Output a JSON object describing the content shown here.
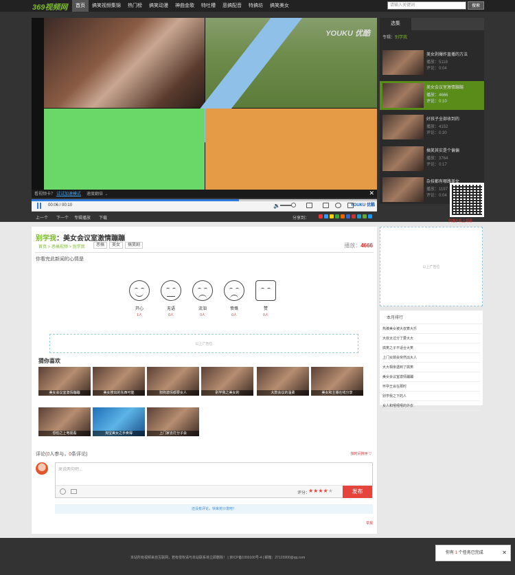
{
  "header": {
    "logo": "369视频网",
    "nav": [
      "首页",
      "搞笑视频集锦",
      "热门榜",
      "搞笑动漫",
      "神曲金歌",
      "特吐槽",
      "恶搞配音",
      "特搞坊",
      "搞笑美女"
    ],
    "search_placeholder": "请输入关键词",
    "search_button": "搜索"
  },
  "player": {
    "watermark": "YOUKU 优酷",
    "tip_prefix": "看视频卡？",
    "tip_link": "试试加速模式",
    "tip_suffix": "速度翻倍 →",
    "time": "00:06 / 00:10",
    "progress": 0.6,
    "youku_small": "YOUKU 优酷",
    "below_items": [
      "上一个",
      "下一个",
      "专辑播放",
      "下载"
    ],
    "share_label": "分享到："
  },
  "playlist": {
    "tab": "选集",
    "current_label": "专辑：",
    "current_name": "别学我",
    "items": [
      {
        "title": "美女剥爆炸直播的方法",
        "plays": "播放：5118",
        "comments": "评论：0:04"
      },
      {
        "title": "美女会议室激情蹦蹦",
        "plays": "播放：4666",
        "comments": "评论：0:10"
      },
      {
        "title": "好孩子全部收到的",
        "plays": "播放：4152",
        "comments": "评论：0:30"
      },
      {
        "title": "搞笑其实是个偏偏",
        "plays": "播放：3764",
        "comments": "评论：0:17"
      },
      {
        "title": "杂技都有哪路美女",
        "plays": "播放：1197",
        "comments": "评论：0:04"
      }
    ],
    "qr_caption": "扫描手机上观看"
  },
  "video_info": {
    "channel": "别学我",
    "title": "：美女会议室激情蹦蹦",
    "breadcrumb": "首页 > 恶搞视频 > 别学我",
    "tags": [
      "恶搞",
      "美女",
      "搞笑剧"
    ],
    "plays_label": "播放：",
    "plays": "4666"
  },
  "mood": {
    "title": "你看完此新闻的心情是",
    "items": [
      {
        "label": "开心",
        "count": "1人"
      },
      {
        "label": "无语",
        "count": "0人"
      },
      {
        "label": "流泪",
        "count": "0人"
      },
      {
        "label": "愤慨",
        "count": "0人"
      },
      {
        "label": "赞",
        "count": "0人"
      }
    ]
  },
  "ads": {
    "mid": "以上广告位",
    "side": "以上广告位"
  },
  "guess": {
    "title": "猜你喜欢",
    "items": [
      "美女会议室激情蹦蹦",
      "美女搜出的东西可能",
      "狗狗激情都要女人",
      "别学我之美女的",
      "大款会议的温柔",
      "美女和主播在线分享",
      "恐怕之上电视看",
      "淘宝美女之手卖得",
      "上门家去打分子会"
    ]
  },
  "comments": {
    "title_prefix": "评论(",
    "joined": "0",
    "title_mid": "人参与，",
    "count": "0",
    "title_suffix": "条评论)",
    "sort": "按时间排序 ▽",
    "placeholder": "来说两句吧...",
    "rate_label": "评分：",
    "rating": 4,
    "submit": "发布",
    "notice": "还没有评论，快来抢沙发吧！",
    "report": "举报"
  },
  "ranking": {
    "title": "本月排行",
    "items": [
      "热裤美女被大叔算大乐",
      "大叔太过分了要大大",
      "搞笑之子不适合大笑",
      "上门女婿会突然出大人",
      "大大相亲遇到了搞笑",
      "美女会议室激情蹦蹦",
      "怀孕王会在那时",
      "别学我之下的人",
      "女人和嘻嘻嘻的外衣"
    ]
  },
  "footer": {
    "text": "本站所有视频来自互联网，若有侵权请与本站联系将立即删除！ | 京ICP备1000100号-4 | 邮箱：27123900@qq.com"
  },
  "toast": {
    "prefix": "你有",
    "count": "1",
    "suffix": "个任务已完成"
  }
}
